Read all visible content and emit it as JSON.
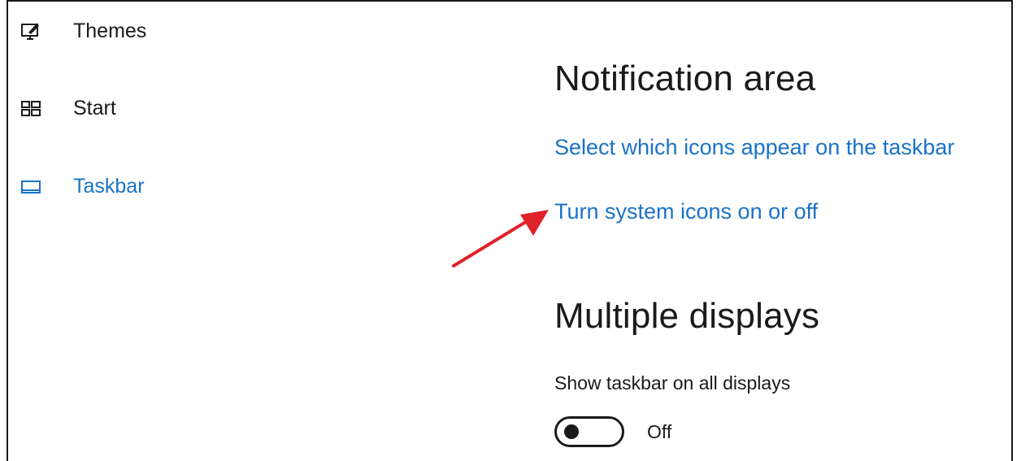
{
  "sidebar": {
    "items": [
      {
        "label": "Themes",
        "icon": "themes-icon",
        "active": false
      },
      {
        "label": "Start",
        "icon": "start-icon",
        "active": false
      },
      {
        "label": "Taskbar",
        "icon": "taskbar-icon",
        "active": true
      }
    ]
  },
  "notification_area": {
    "title": "Notification area",
    "select_icons_link": "Select which icons appear on the taskbar",
    "system_icons_link": "Turn system icons on or off"
  },
  "multiple_displays": {
    "title": "Multiple displays",
    "show_taskbar_label": "Show taskbar on all displays",
    "toggle_state": "Off",
    "toggle_on": false
  },
  "annotation": {
    "arrow_color": "#e0232a",
    "arrow_icon": "red-arrow-icon"
  },
  "colors": {
    "accent": "#1a73c8",
    "text": "#1a1a1a",
    "background": "#ffffff"
  }
}
